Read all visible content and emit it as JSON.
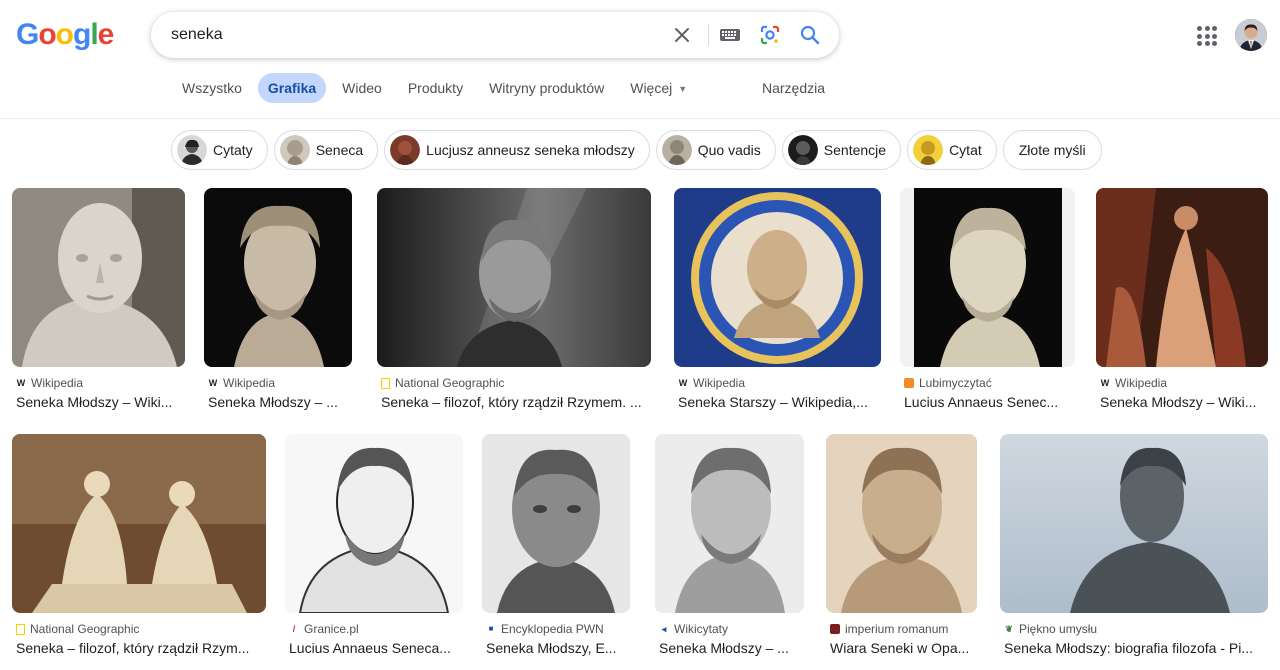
{
  "logo": {
    "letters": [
      "G",
      "o",
      "o",
      "g",
      "l",
      "e"
    ],
    "colors": [
      "#4285F4",
      "#EA4335",
      "#FBBC05",
      "#4285F4",
      "#34A853",
      "#EA4335"
    ]
  },
  "search": {
    "query": "seneka"
  },
  "icons": {
    "clear": "close-icon",
    "keyboard": "keyboard-icon",
    "lens": "lens-icon",
    "search": "search-icon",
    "apps": "apps-icon"
  },
  "tabs": [
    {
      "label": "Wszystko"
    },
    {
      "label": "Grafika",
      "active": true
    },
    {
      "label": "Wideo"
    },
    {
      "label": "Produkty"
    },
    {
      "label": "Witryny produktów"
    },
    {
      "label": "Więcej"
    }
  ],
  "tools_label": "Narzędzia",
  "chips": [
    {
      "label": "Cytaty"
    },
    {
      "label": "Seneca"
    },
    {
      "label": "Lucjusz anneusz seneka młodszy"
    },
    {
      "label": "Quo vadis"
    },
    {
      "label": "Sentencje"
    },
    {
      "label": "Cytat"
    },
    {
      "label": "Złote myśli"
    }
  ],
  "results": [
    {
      "source": "Wikipedia",
      "title": "Seneka Młodszy – Wiki...",
      "favicon": "W"
    },
    {
      "source": "Wikipedia",
      "title": "Seneka Młodszy – ...",
      "favicon": "W"
    },
    {
      "source": "National Geographic",
      "title": "Seneka – filozof, który rządził Rzymem. ...",
      "favicon": "NG"
    },
    {
      "source": "Wikipedia",
      "title": "Seneka Starszy – Wikipedia,...",
      "favicon": "W"
    },
    {
      "source": "Lubimyczytać",
      "title": "Lucius Annaeus Senec...",
      "favicon": "LC"
    },
    {
      "source": "Wikipedia",
      "title": "Seneka Młodszy – Wiki...",
      "favicon": "W"
    },
    {
      "source": "National Geographic",
      "title": "Seneka – filozof, który rządził Rzym...",
      "favicon": "NG"
    },
    {
      "source": "Granice.pl",
      "title": "Lucius Annaeus Seneca...",
      "favicon": "GR"
    },
    {
      "source": "Encyklopedia PWN",
      "title": "Seneka Młodszy, E...",
      "favicon": "PWN"
    },
    {
      "source": "Wikicytaty",
      "title": "Seneka Młodszy – ...",
      "favicon": "WC"
    },
    {
      "source": "imperium romanum",
      "title": "Wiara Seneki w Opa...",
      "favicon": "IR"
    },
    {
      "source": "Piękno umysłu",
      "title": "Seneka Młodszy: biografia filozofa - Pi...",
      "favicon": "PU"
    }
  ]
}
